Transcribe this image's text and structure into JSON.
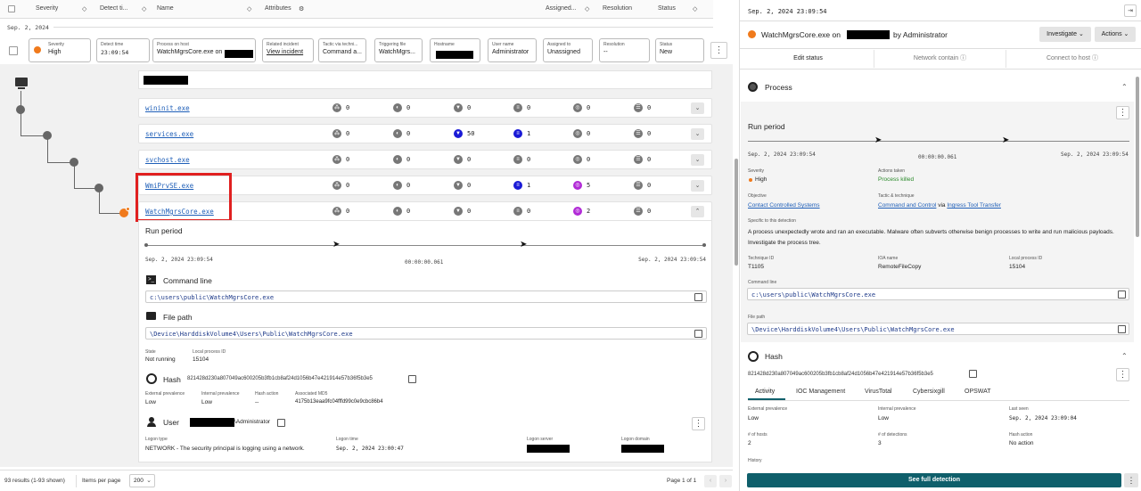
{
  "columns": {
    "severity": "Severity",
    "detect_time": "Detect ti...",
    "name": "Name",
    "attributes": "Attributes",
    "assigned": "Assigned...",
    "resolution": "Resolution",
    "status": "Status"
  },
  "date_group": "Sep. 2, 2024",
  "summary": {
    "severity_label": "Severity",
    "severity_value": "High",
    "detect_label": "Detect time",
    "detect_value": "23:09:54",
    "process_label": "Process on host",
    "process_value": "WatchMgrsCore.exe on",
    "incident_label": "Related incident",
    "incident_value": "View incident",
    "tactic_label": "Tactic via techni...",
    "tactic_value": "Command a...",
    "trigger_label": "Triggering file",
    "trigger_value": "WatchMgrs...",
    "host_label": "Hostname",
    "user_label": "User name",
    "user_value": "Administrator",
    "assigned_label": "Assigned to",
    "assigned_value": "Unassigned",
    "resolution_label": "Resolution",
    "resolution_value": "--",
    "status_label": "Status",
    "status_value": "New"
  },
  "processes": [
    {
      "name": "wininit.exe",
      "s1": "0",
      "s2": "0",
      "s3": "0",
      "s4": "0",
      "s5": "0",
      "s6": "0"
    },
    {
      "name": "services.exe",
      "s1": "0",
      "s2": "0",
      "s3": "50",
      "s4": "1",
      "s5": "0",
      "s6": "0"
    },
    {
      "name": "svchost.exe",
      "s1": "0",
      "s2": "0",
      "s3": "0",
      "s4": "0",
      "s5": "0",
      "s6": "0"
    },
    {
      "name": "WmiPrvSE.exe",
      "s1": "0",
      "s2": "0",
      "s3": "0",
      "s4": "1",
      "s5": "5",
      "s6": "0"
    },
    {
      "name": "WatchMgrsCore.exe",
      "s1": "0",
      "s2": "0",
      "s3": "0",
      "s4": "0",
      "s5": "2",
      "s6": "0"
    }
  ],
  "detail": {
    "run_period": "Run period",
    "start": "Sep. 2, 2024 23:09:54",
    "duration": "00:00:00.061",
    "end": "Sep. 2, 2024 23:09:54",
    "cmd_title": "Command line",
    "cmd_value": "c:\\users\\public\\WatchMgrsCore.exe",
    "path_title": "File path",
    "path_value": "\\Device\\HarddiskVolume4\\Users\\Public\\WatchMgrsCore.exe",
    "state_label": "State",
    "state_value": "Not running",
    "pid_label": "Local process ID",
    "pid_value": "15104",
    "hash_title": "Hash",
    "hash_value": "821428d230a807049ac600205b3fb1cb8af24d1056b47e421914e57b36f5b3e5",
    "ext_prev_label": "External prevalence",
    "ext_prev_value": "Low",
    "int_prev_label": "Internal prevalence",
    "int_prev_value": "Low",
    "hash_action_label": "Hash action",
    "hash_action_value": "--",
    "md5_label": "Associated MD5",
    "md5_value": "4175b13eaa9fc04fffd99c0e9cbc86b4",
    "user_title": "User",
    "user_suffix": "\\Administrator",
    "logon_type_label": "Logon type",
    "logon_type_value": "NETWORK - The security principal is logging using a network.",
    "logon_time_label": "Logon time",
    "logon_time_value": "Sep. 2, 2024 23:00:47",
    "logon_server_label": "Logon server",
    "logon_domain_label": "Logon domain"
  },
  "bottom": {
    "results": "93 results (1-93 shown)",
    "per_page_label": "Items per page",
    "per_page_value": "200",
    "page": "Page 1 of 1"
  },
  "panel": {
    "timestamp": "Sep. 2, 2024 23:09:54",
    "title_prefix": "WatchMgrsCore.exe on",
    "title_suffix": "by Administrator",
    "investigate": "Investigate",
    "actions": "Actions",
    "tabs": [
      "Edit status",
      "Network contain",
      "Connect to host"
    ],
    "process_title": "Process",
    "run_period": "Run period",
    "start": "Sep. 2, 2024 23:09:54",
    "duration": "00:00:00.061",
    "end": "Sep. 2, 2024 23:09:54",
    "severity_label": "Severity",
    "severity_value": "High",
    "actions_label": "Actions taken",
    "actions_value": "Process killed",
    "objective_label": "Objective",
    "objective_value": "Contact Controlled Systems",
    "tactic_label": "Tactic & technique",
    "tactic_value": "Command and Control",
    "tactic_via": "via",
    "technique_value": "Ingress Tool Transfer",
    "specific_label": "Specific to this detection",
    "specific_value": "A process unexpectedly wrote and ran an executable. Malware often subverts otherwise benign processes to write and run malicious payloads. Investigate the process tree.",
    "technique_id_label": "Technique ID",
    "technique_id_value": "T1105",
    "ioa_label": "IOA name",
    "ioa_value": "RemoteFileCopy",
    "pid_label": "Local process ID",
    "pid_value": "15104",
    "cmd_label": "Command line",
    "cmd_value": "c:\\users\\public\\WatchMgrsCore.exe",
    "path_label": "File path",
    "path_value": "\\Device\\HarddiskVolume4\\Users\\Public\\WatchMgrsCore.exe",
    "hash_title": "Hash",
    "hash_value": "821428d230a807049ac600205b3fb1cb8af24d1056b47e421914e57b36f5b3e5",
    "hash_tabs": [
      "Activity",
      "IOC Management",
      "VirusTotal",
      "Cybersixgill",
      "OPSWAT"
    ],
    "ext_prev_label": "External prevalence",
    "ext_prev_value": "Low",
    "int_prev_label": "Internal prevalence",
    "int_prev_value": "Low",
    "last_seen_label": "Last seen",
    "last_seen_value": "Sep. 2, 2024 23:09:04",
    "hosts_label": "# of hosts",
    "hosts_value": "2",
    "detections_label": "# of detections",
    "detections_value": "3",
    "hash_action_label": "Hash action",
    "hash_action_value": "No action",
    "history_label": "History",
    "see_full": "See full detection"
  },
  "colors": {
    "accent": "#0f5f6b",
    "highlight": "#e02020",
    "orange": "#f07a1c"
  }
}
